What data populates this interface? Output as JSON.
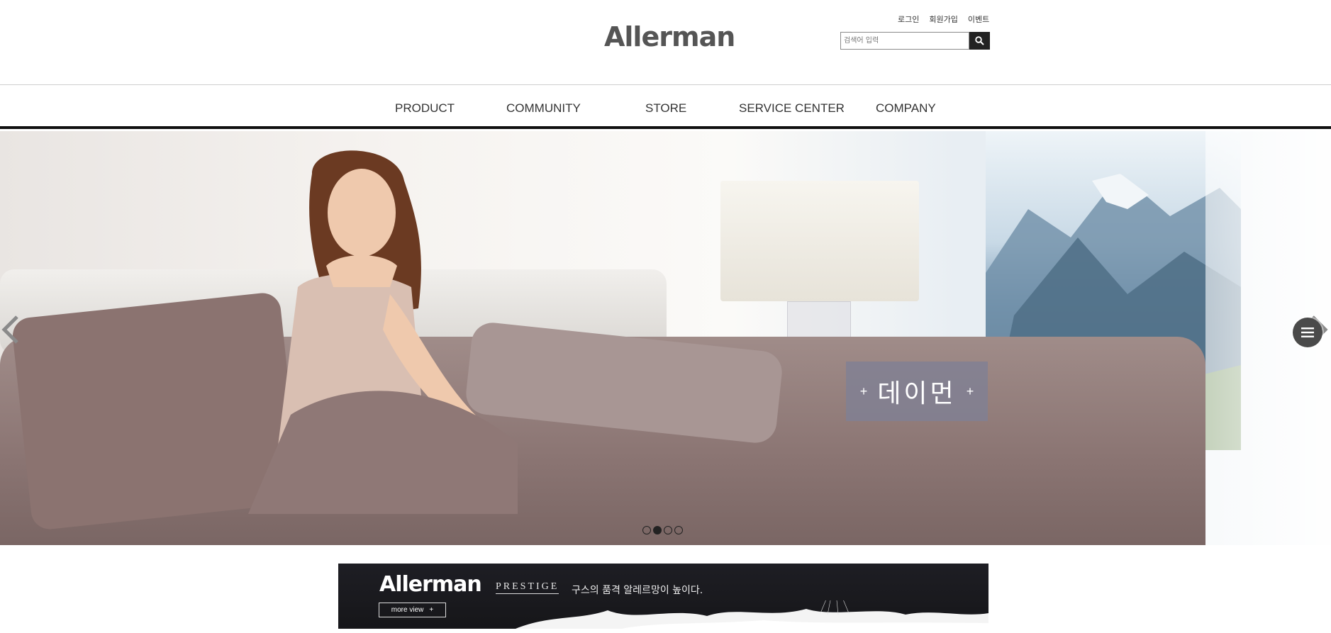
{
  "header": {
    "logo": "Allerman",
    "toplinks": [
      "로그인",
      "회원가입",
      "이벤트"
    ],
    "search": {
      "placeholder": "검색어 입력",
      "button_icon": "search-icon"
    }
  },
  "nav": {
    "items": [
      "PRODUCT",
      "COMMUNITY",
      "STORE",
      "SERVICE CENTER",
      "COMPANY"
    ]
  },
  "hero": {
    "caption": "데이먼",
    "caption_plus": "+",
    "prev_icon": "chevron-left-icon",
    "next_icon": "chevron-right-icon",
    "menu_icon": "hamburger-icon",
    "slides": 4,
    "active_slide": 2
  },
  "banner": {
    "logo": "Allerman",
    "sub_brand": "PRESTIGE",
    "tagline": "구스의 품격 알레르망이 높이다.",
    "more_label": "more view",
    "more_icon": "plus-icon"
  },
  "colors": {
    "nav_underline": "#111111",
    "caption_bg": "#808094",
    "banner_bg": "#1a1a1f"
  }
}
